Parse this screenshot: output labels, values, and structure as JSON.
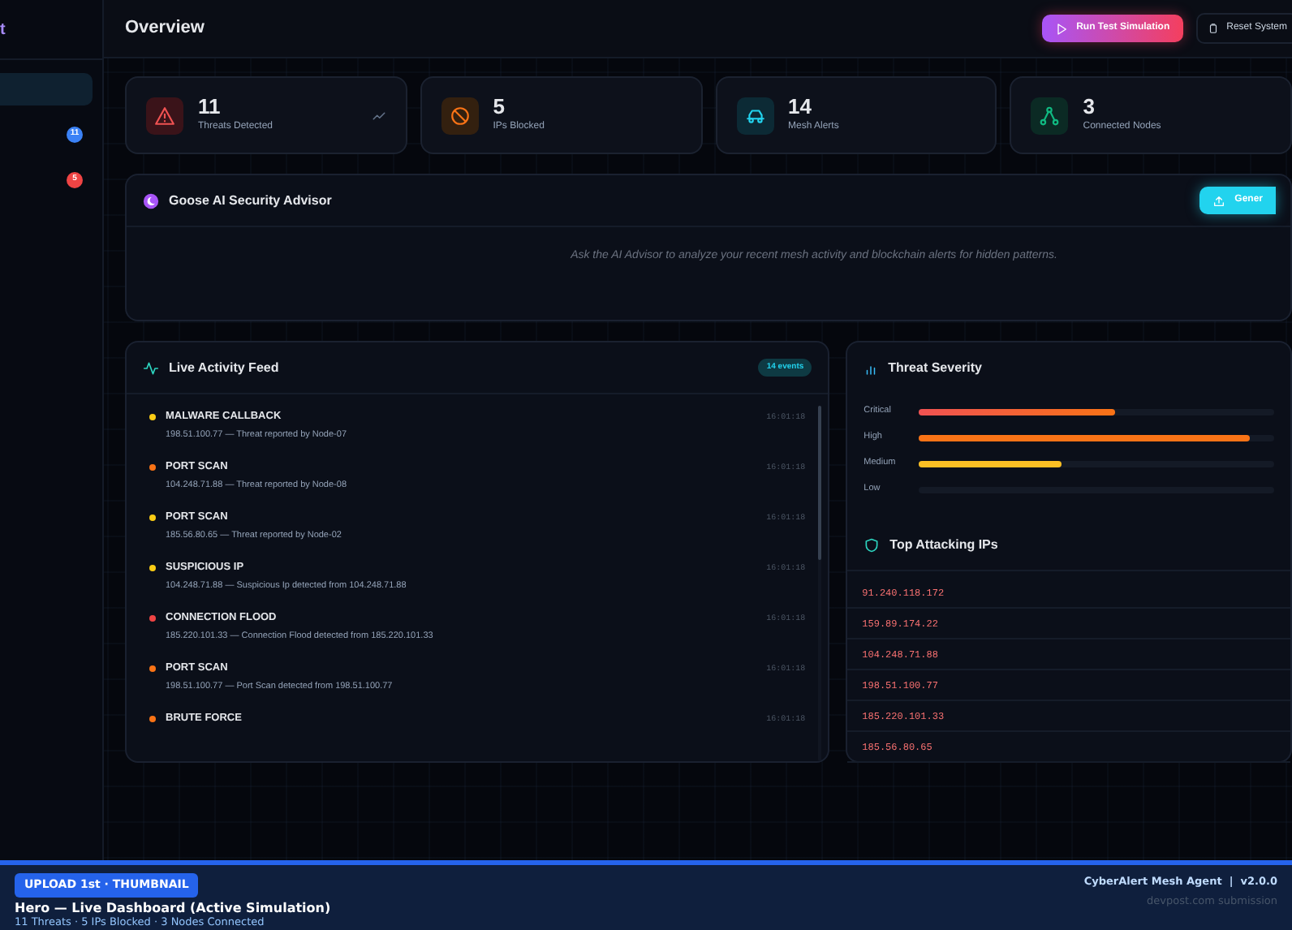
{
  "sidebar": {
    "brand": "t",
    "items": [
      {
        "selected": true
      },
      {
        "selected": false,
        "badge": "11",
        "color": "#3b82f6"
      },
      {
        "selected": false,
        "badge": "5",
        "color": "#ef4444"
      }
    ]
  },
  "header": {
    "title": "Overview",
    "buttons": [
      {
        "kind": "primary",
        "label": "Run Test Simulation"
      },
      {
        "kind": "secondary",
        "label": "Reset System"
      }
    ]
  },
  "stats": [
    {
      "kind": "threats",
      "value": "11",
      "label": "Threats Detected",
      "trend": true
    },
    {
      "kind": "blocked",
      "value": "5",
      "label": "IPs Blocked",
      "trend": false
    },
    {
      "kind": "mesh",
      "value": "14",
      "label": "Mesh Alerts",
      "trend": false
    },
    {
      "kind": "nodes",
      "value": "3",
      "label": "Connected Nodes",
      "trend": false
    }
  ],
  "advisor": {
    "title": "Goose AI Security Advisor",
    "button": "Gener",
    "hint": "Ask the AI Advisor to analyze your recent mesh activity and blockchain alerts for hidden patterns."
  },
  "feed": {
    "title": "Live Activity Feed",
    "badge": "14 events",
    "events": [
      {
        "title": "MALWARE CALLBACK",
        "detail": "198.51.100.77 — Threat reported by Node-07",
        "time": "16:01:18",
        "color": "#facc15"
      },
      {
        "title": "PORT SCAN",
        "detail": "104.248.71.88 — Threat reported by Node-08",
        "time": "16:01:18",
        "color": "#f97316"
      },
      {
        "title": "PORT SCAN",
        "detail": "185.56.80.65 — Threat reported by Node-02",
        "time": "16:01:18",
        "color": "#facc15"
      },
      {
        "title": "SUSPICIOUS IP",
        "detail": "104.248.71.88 — Suspicious Ip detected from 104.248.71.88",
        "time": "16:01:18",
        "color": "#facc15"
      },
      {
        "title": "CONNECTION FLOOD",
        "detail": "185.220.101.33 — Connection Flood detected from 185.220.101.33",
        "time": "16:01:18",
        "color": "#ef4444"
      },
      {
        "title": "PORT SCAN",
        "detail": "198.51.100.77 — Port Scan detected from 198.51.100.77",
        "time": "16:01:18",
        "color": "#f97316"
      },
      {
        "title": "BRUTE FORCE",
        "time": "16:01:18",
        "color": "#f97316"
      }
    ]
  },
  "severity": {
    "title": "Threat Severity",
    "levels": [
      {
        "kind": "critical",
        "label": "Critical",
        "level": 0.55
      },
      {
        "kind": "high",
        "label": "High",
        "level": 0.93
      },
      {
        "kind": "medium",
        "label": "Medium",
        "level": 0.4
      },
      {
        "kind": "low",
        "label": "Low"
      }
    ]
  },
  "top_ips": {
    "title": "Top Attacking IPs",
    "ips": [
      "91.240.118.172",
      "159.89.174.22",
      "104.248.71.88",
      "198.51.100.77",
      "185.220.101.33",
      "185.56.80.65"
    ]
  },
  "footer": {
    "tag": "UPLOAD 1st · THUMBNAIL",
    "title": "Hero — Live Dashboard (Active Simulation)",
    "subtitle": "11 Threats · 5 IPs Blocked · 3 Nodes Connected",
    "app": "CyberAlert Mesh Agent  |  v2.0.0",
    "note": "devpost.com submission"
  }
}
